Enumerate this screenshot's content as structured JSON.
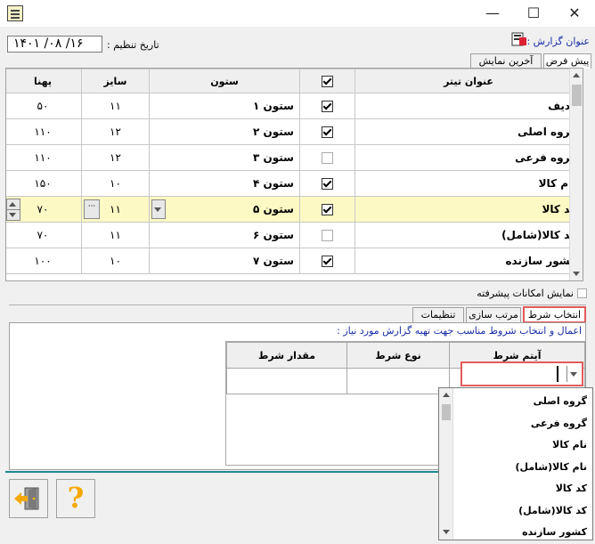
{
  "window": {
    "controls": {
      "minimize": "—",
      "maximize": "☐",
      "close": "✕"
    }
  },
  "header": {
    "report_title_label": "عنوان گزارش :",
    "date_label": "تاریخ تنظیم :",
    "date_value": "۱۴۰۱ /۰۸ /۱۶"
  },
  "top_tabs": [
    "پیش فرض",
    "آخرین نمایش"
  ],
  "grid": {
    "columns": [
      "عنوان تیتر",
      "",
      "ستون",
      "سایز",
      "پهنا"
    ],
    "rows": [
      {
        "title": "ردیف",
        "checked": true,
        "column": "ستون ۱",
        "size": "۱۱",
        "width": "۵۰"
      },
      {
        "title": "گروه اصلی",
        "checked": true,
        "column": "ستون ۲",
        "size": "۱۲",
        "width": "۱۱۰"
      },
      {
        "title": "گروه فرعی",
        "checked": false,
        "column": "ستون ۳",
        "size": "۱۲",
        "width": "۱۱۰"
      },
      {
        "title": "نام کالا",
        "checked": true,
        "column": "ستون ۴",
        "size": "۱۰",
        "width": "۱۵۰"
      },
      {
        "title": "کد کالا",
        "checked": true,
        "column": "ستون ۵",
        "size": "۱۱",
        "width": "۷۰"
      },
      {
        "title": "کد کالا(شامل)",
        "checked": false,
        "column": "ستون ۶",
        "size": "۱۱",
        "width": "۷۰"
      },
      {
        "title": "کشور سازنده",
        "checked": true,
        "column": "ستون ۷",
        "size": "۱۰",
        "width": "۱۰۰"
      }
    ],
    "selected_row": 4
  },
  "advanced_option_label": "نمایش امکانات پیشرفته",
  "bottom_tabs": [
    "انتخاب شرط",
    "مرتب سازی",
    "تنظیمات"
  ],
  "condition": {
    "instruction": "اعمال و انتخاب شروط مناسب جهت تهیه گزارش  مورد نیاز :",
    "columns": [
      "آیتم شرط",
      "نوع شرط",
      "مقدار شرط"
    ],
    "dropdown_items": [
      "گروه اصلی",
      "گروه فرعی",
      "نام کالا",
      "نام کالا(شامل)",
      "کد کالا",
      "کد کالا(شامل)",
      "کشور سازنده"
    ]
  },
  "buttons": {
    "help_glyph": "?"
  },
  "colors": {
    "highlight": "#e35b5b",
    "selected_row": "#fdf9c4",
    "instruction_text": "#1a2ea8",
    "status_bar": "#1f8a92"
  }
}
